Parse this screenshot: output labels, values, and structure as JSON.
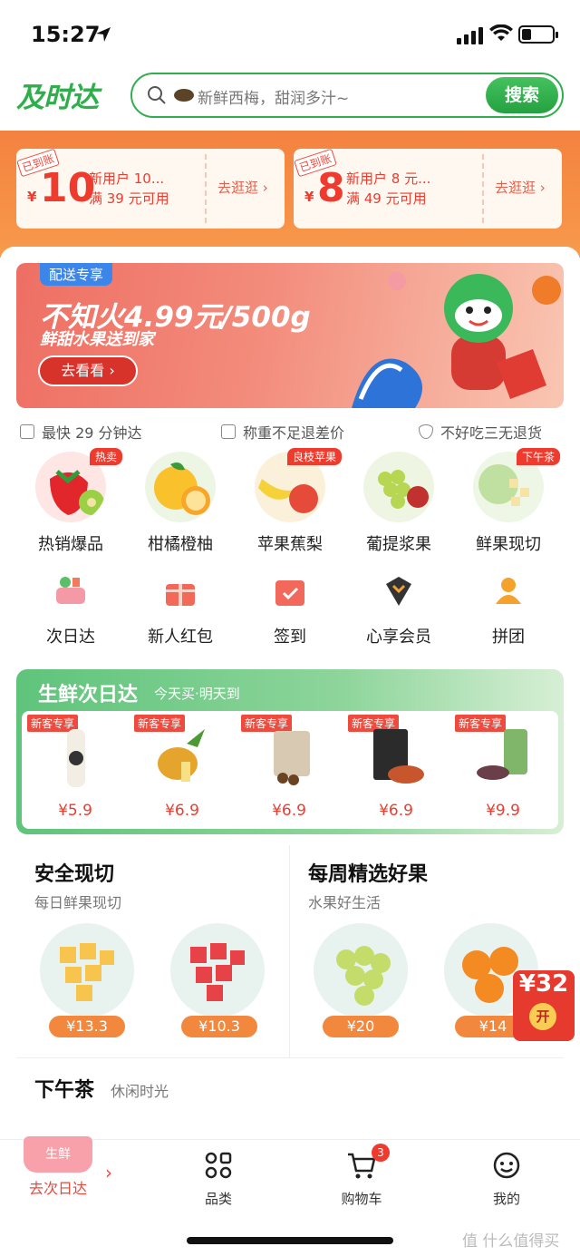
{
  "status": {
    "time": "15:27"
  },
  "header": {
    "logo": "及时达",
    "search_placeholder": "新鲜西梅，甜润多汁~",
    "search_button": "搜索"
  },
  "coupons": [
    {
      "tag": "已到账",
      "yen": "¥",
      "amount": "10",
      "line1": "新用户 10...",
      "line2": "满 39 元可用",
      "action": "去逛逛 ›"
    },
    {
      "tag": "已到账",
      "yen": "¥",
      "amount": "8",
      "line1": "新用户 8 元...",
      "line2": "满 49 元可用",
      "action": "去逛逛 ›"
    }
  ],
  "banner": {
    "badge": "配送专享",
    "title": "不知火4.99元/500g",
    "subtitle": "鲜甜水果送到家",
    "cta": "去看看 ›"
  },
  "promises": [
    "最快 29 分钟达",
    "称重不足退差价",
    "不好吃三无退货"
  ],
  "categories": [
    {
      "label": "热销爆品",
      "tag": "热卖"
    },
    {
      "label": "柑橘橙柚",
      "tag": ""
    },
    {
      "label": "苹果蕉梨",
      "tag": "良枝苹果"
    },
    {
      "label": "葡提浆果",
      "tag": ""
    },
    {
      "label": "鲜果现切",
      "tag": "下午茶"
    }
  ],
  "shortcuts": [
    {
      "label": "次日达",
      "icon": "basket-icon"
    },
    {
      "label": "新人红包",
      "icon": "gift-icon"
    },
    {
      "label": "签到",
      "icon": "calendar-check-icon"
    },
    {
      "label": "心享会员",
      "icon": "diamond-icon"
    },
    {
      "label": "拼团",
      "icon": "group-icon"
    }
  ],
  "next_day": {
    "title": "生鲜次日达",
    "subtitle": "今天买·明天到",
    "items": [
      {
        "tag": "新客专享",
        "price": "¥5.9"
      },
      {
        "tag": "新客专享",
        "price": "¥6.9"
      },
      {
        "tag": "新客专享",
        "price": "¥6.9"
      },
      {
        "tag": "新客专享",
        "price": "¥6.9"
      },
      {
        "tag": "新客专享",
        "price": "¥9.9"
      }
    ]
  },
  "sections": [
    {
      "title": "安全现切",
      "subtitle": "每日鲜果现切",
      "prices": [
        "¥13.3",
        "¥10.3"
      ]
    },
    {
      "title": "每周精选好果",
      "subtitle": "水果好生活",
      "prices": [
        "¥20",
        "¥14"
      ]
    }
  ],
  "afternoon_tea": {
    "title": "下午茶",
    "subtitle": "休闲时光"
  },
  "red_packet": {
    "amount": "¥32",
    "open": "开"
  },
  "tabbar": {
    "fresh_basket": "生鲜",
    "fresh_label": "去次日达",
    "tabs": [
      "品类",
      "购物车",
      "我的"
    ],
    "cart_badge": "3"
  },
  "watermark": "值 什么值得买"
}
